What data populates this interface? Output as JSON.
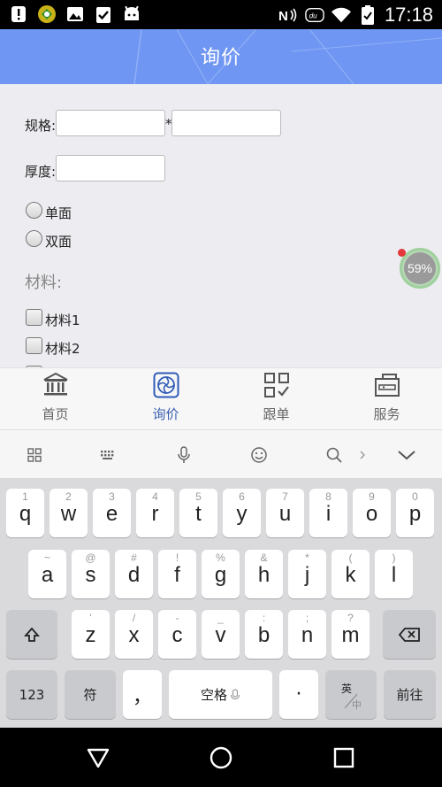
{
  "status_bar": {
    "time": "17:18",
    "left_icons": [
      "alert-icon",
      "app-icon",
      "image-icon",
      "clipboard-icon",
      "android-icon"
    ],
    "right_icons": [
      "nfc-icon",
      "app-du-icon",
      "wifi-icon",
      "battery-icon"
    ]
  },
  "header": {
    "title": "询价"
  },
  "form": {
    "spec_label": "规格:",
    "spec_separator": "*",
    "thickness_label": "厚度:",
    "sides": [
      {
        "label": "单面"
      },
      {
        "label": "双面"
      }
    ],
    "material_title": "材料:",
    "materials": [
      {
        "label": "材料1"
      },
      {
        "label": "材料2"
      }
    ]
  },
  "floating_badge": {
    "value": "59%",
    "accent": "#9fd09d"
  },
  "tabs": [
    {
      "label": "首页",
      "icon": "bank-icon",
      "active": false
    },
    {
      "label": "询价",
      "icon": "aperture-icon",
      "active": true
    },
    {
      "label": "跟单",
      "icon": "qr-check-icon",
      "active": false
    },
    {
      "label": "服务",
      "icon": "toolbox-icon",
      "active": false
    }
  ],
  "keyboard_toolbar": {
    "icons": [
      "grid-icon",
      "keyboard-icon",
      "mic-icon",
      "emoji-icon",
      "search-icon",
      "chevron-right-icon",
      "chevron-down-icon"
    ]
  },
  "keyboard": {
    "row1": [
      {
        "hint": "1",
        "key": "q"
      },
      {
        "hint": "2",
        "key": "w"
      },
      {
        "hint": "3",
        "key": "e"
      },
      {
        "hint": "4",
        "key": "r"
      },
      {
        "hint": "5",
        "key": "t"
      },
      {
        "hint": "6",
        "key": "y"
      },
      {
        "hint": "7",
        "key": "u"
      },
      {
        "hint": "8",
        "key": "i"
      },
      {
        "hint": "9",
        "key": "o"
      },
      {
        "hint": "0",
        "key": "p"
      }
    ],
    "row2": [
      {
        "hint": "~",
        "key": "a"
      },
      {
        "hint": "@",
        "key": "s"
      },
      {
        "hint": "#",
        "key": "d"
      },
      {
        "hint": "!",
        "key": "f"
      },
      {
        "hint": "%",
        "key": "g"
      },
      {
        "hint": "&",
        "key": "h"
      },
      {
        "hint": "*",
        "key": "j"
      },
      {
        "hint": "(",
        "key": "k"
      },
      {
        "hint": ")",
        "key": "l"
      }
    ],
    "row3": [
      {
        "hint": "'",
        "key": "z"
      },
      {
        "hint": "/",
        "key": "x"
      },
      {
        "hint": "-",
        "key": "c"
      },
      {
        "hint": "_",
        "key": "v"
      },
      {
        "hint": ":",
        "key": "b"
      },
      {
        "hint": ";",
        "key": "n"
      },
      {
        "hint": "?",
        "key": "m"
      }
    ],
    "num_label": "123",
    "symbol_label": "符",
    "comma_label": "，",
    "space_label": "空格",
    "period_label": "·",
    "lang_top": "英",
    "lang_bottom": "中",
    "enter_label": "前往"
  },
  "colors": {
    "header": "#6f96f2",
    "active_tab": "#3a5fb0",
    "keyboard_bg": "#dadadd"
  }
}
